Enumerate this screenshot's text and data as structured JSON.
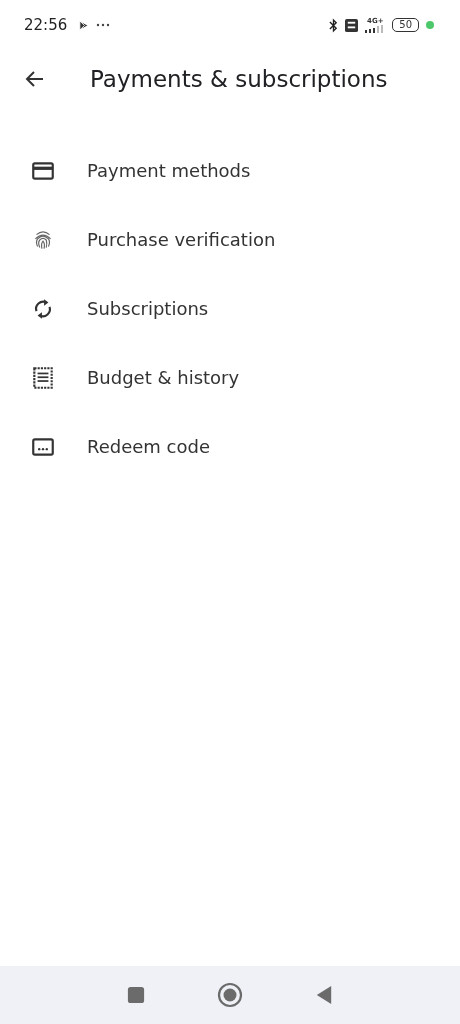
{
  "status_bar": {
    "time": "22:56",
    "network": "4G+",
    "battery": "50"
  },
  "header": {
    "title": "Payments & subscriptions"
  },
  "items": [
    {
      "label": "Payment methods",
      "kind": "card"
    },
    {
      "label": "Purchase verification",
      "kind": "fingerprint"
    },
    {
      "label": "Subscriptions",
      "kind": "sync"
    },
    {
      "label": "Budget & history",
      "kind": "receipt"
    },
    {
      "label": "Redeem code",
      "kind": "code"
    }
  ]
}
